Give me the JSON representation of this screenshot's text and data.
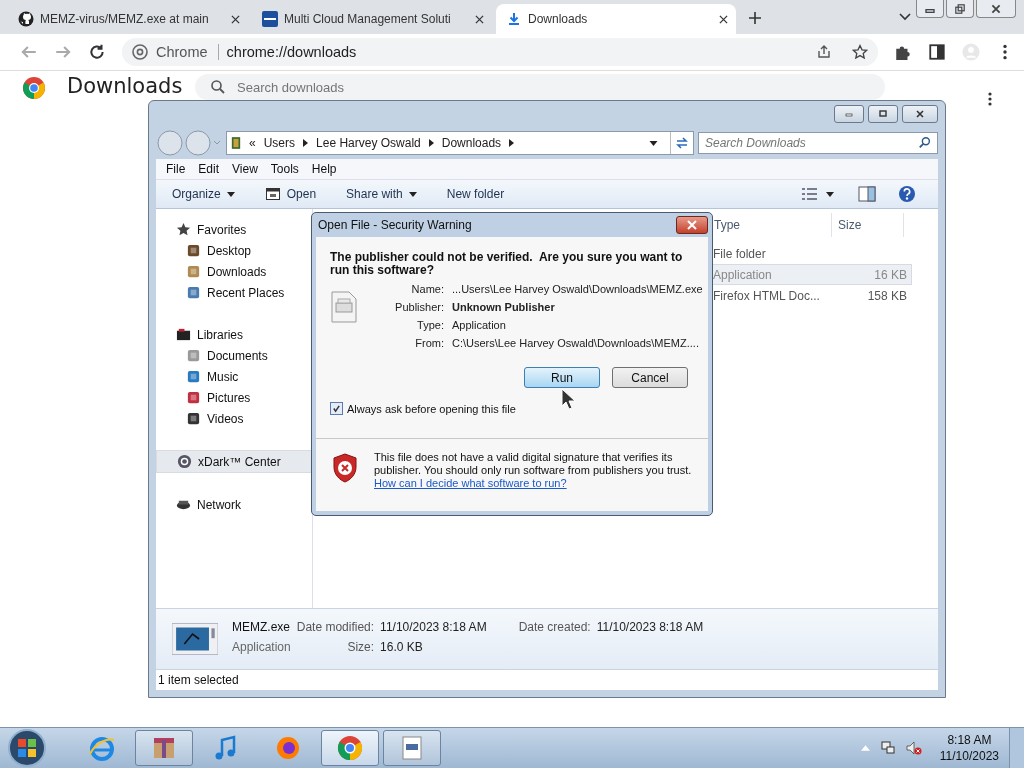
{
  "browser": {
    "tabs": [
      {
        "title": "MEMZ-virus/MEMZ.exe at main",
        "selected": false
      },
      {
        "title": "Multi Cloud Management Soluti",
        "selected": false
      },
      {
        "title": "Downloads",
        "selected": true
      }
    ],
    "address": {
      "chip": "Chrome",
      "url": "chrome://downloads"
    }
  },
  "page": {
    "heading": "Downloads",
    "search": {
      "placeholder": "Search downloads"
    }
  },
  "explorer": {
    "overflow": "«",
    "breadcrumb": [
      "Users",
      "Lee Harvey Oswald",
      "Downloads"
    ],
    "search": {
      "placeholder": "Search Downloads"
    },
    "menu": [
      "File",
      "Edit",
      "View",
      "Tools",
      "Help"
    ],
    "toolbar": [
      {
        "label": "Organize",
        "dropdown": true
      },
      {
        "label": "Open",
        "dropdown": false
      },
      {
        "label": "Share with",
        "dropdown": true
      },
      {
        "label": "New folder",
        "dropdown": false
      }
    ],
    "nav": [
      {
        "label": "Favorites",
        "selected": false,
        "children": [
          {
            "label": "Desktop",
            "selected": false
          },
          {
            "label": "Downloads",
            "selected": false
          },
          {
            "label": "Recent Places",
            "selected": false
          }
        ]
      },
      {
        "label": "Libraries",
        "selected": false,
        "children": [
          {
            "label": "Documents",
            "selected": false
          },
          {
            "label": "Music",
            "selected": false
          },
          {
            "label": "Pictures",
            "selected": false
          },
          {
            "label": "Videos",
            "selected": false
          }
        ]
      },
      {
        "label": "xDark™ Center",
        "selected": true
      },
      {
        "label": "Network",
        "selected": false
      }
    ],
    "columns": [
      "Type",
      "Size"
    ],
    "rows": [
      {
        "type": "File folder",
        "selected": false
      },
      {
        "type": "Application",
        "size": "16 KB",
        "selected": true
      },
      {
        "type": "Firefox HTML Doc...",
        "size": "158 KB",
        "selected": false
      }
    ],
    "details": {
      "name": "MEMZ.exe",
      "type": "Application",
      "rows": [
        [
          {
            "label": "Date modified:",
            "value": "11/10/2023 8:18 AM"
          },
          {
            "label": "Date created:",
            "value": "11/10/2023 8:18 AM"
          }
        ],
        [
          {
            "label": "Size:",
            "value": "16.0 KB"
          }
        ]
      ]
    },
    "status": "1 item selected"
  },
  "dialog": {
    "title": "Open File - Security Warning",
    "heading": "The publisher could not be verified.  Are you sure you want to run this software?",
    "fields": [
      {
        "label": "Name:",
        "value": "...Users\\Lee Harvey Oswald\\Downloads\\MEMZ.exe",
        "bold": false
      },
      {
        "label": "Publisher:",
        "value": "Unknown Publisher",
        "bold": true
      },
      {
        "label": "Type:",
        "value": "Application",
        "bold": false
      },
      {
        "label": "From:",
        "value": "C:\\Users\\Lee Harvey Oswald\\Downloads\\MEMZ....",
        "bold": false
      }
    ],
    "buttons": [
      {
        "label": "Run",
        "default": true
      },
      {
        "label": "Cancel",
        "default": false
      }
    ],
    "checkbox": {
      "label": "Always ask before opening this file",
      "checked": true
    },
    "warning": {
      "text": "This file does not have a valid digital signature that verifies its publisher.  You should only run software from publishers you trust.",
      "link": "How can I decide what software to run?"
    }
  },
  "taskbar": {
    "apps": [
      {
        "running": false
      },
      {
        "running": true
      },
      {
        "running": false
      },
      {
        "running": false
      },
      {
        "running": true
      },
      {
        "running": true
      }
    ],
    "time": "8:18 AM",
    "date": "11/10/2023"
  }
}
